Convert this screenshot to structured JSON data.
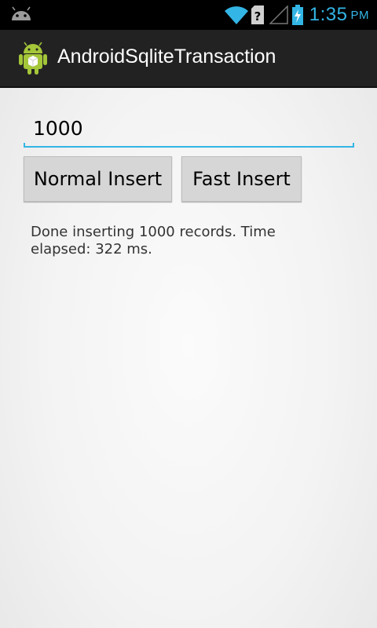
{
  "status_bar": {
    "time": "1:35",
    "ampm": "PM",
    "accent_color": "#33b5e5",
    "icons": [
      "android-notification-icon",
      "wifi-icon",
      "unknown-sim-icon",
      "signal-icon",
      "battery-charging-icon"
    ]
  },
  "action_bar": {
    "title": "AndroidSqliteTransaction",
    "icon": "android-app-icon"
  },
  "form": {
    "record_count_value": "1000",
    "normal_insert_label": "Normal Insert",
    "fast_insert_label": "Fast Insert"
  },
  "result": {
    "message": "Done inserting 1000 records. Time elapsed: 322 ms."
  }
}
